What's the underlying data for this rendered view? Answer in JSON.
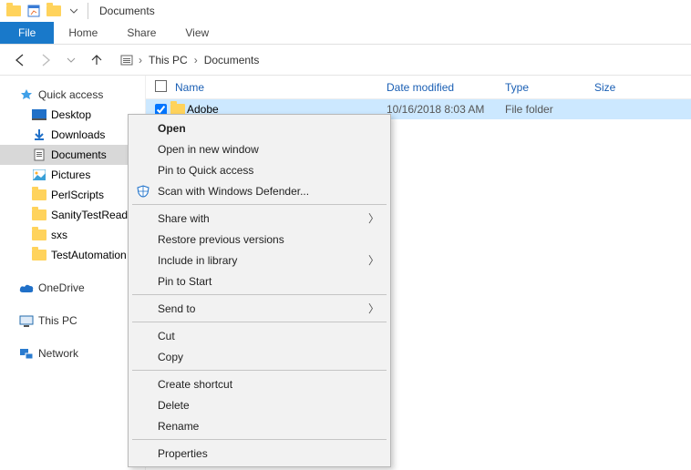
{
  "title": "Documents",
  "ribbon": {
    "file": "File",
    "home": "Home",
    "share": "Share",
    "view": "View"
  },
  "breadcrumb": {
    "root": "This PC",
    "current": "Documents"
  },
  "sidebar": {
    "quick": "Quick access",
    "items": [
      "Desktop",
      "Downloads",
      "Documents",
      "Pictures",
      "PerlScripts",
      "SanityTestRead",
      "sxs",
      "TestAutomation"
    ],
    "onedrive": "OneDrive",
    "thispc": "This PC",
    "network": "Network"
  },
  "columns": {
    "name": "Name",
    "date": "Date modified",
    "type": "Type",
    "size": "Size"
  },
  "rows": [
    {
      "name": "Adobe",
      "date": "10/16/2018 8:03 AM",
      "type": "File folder"
    }
  ],
  "ctx": {
    "open": "Open",
    "newwin": "Open in new window",
    "pinqa": "Pin to Quick access",
    "defender": "Scan with Windows Defender...",
    "share": "Share with",
    "restore": "Restore previous versions",
    "library": "Include in library",
    "pinstart": "Pin to Start",
    "sendto": "Send to",
    "cut": "Cut",
    "copy": "Copy",
    "shortcut": "Create shortcut",
    "delete": "Delete",
    "rename": "Rename",
    "props": "Properties"
  }
}
